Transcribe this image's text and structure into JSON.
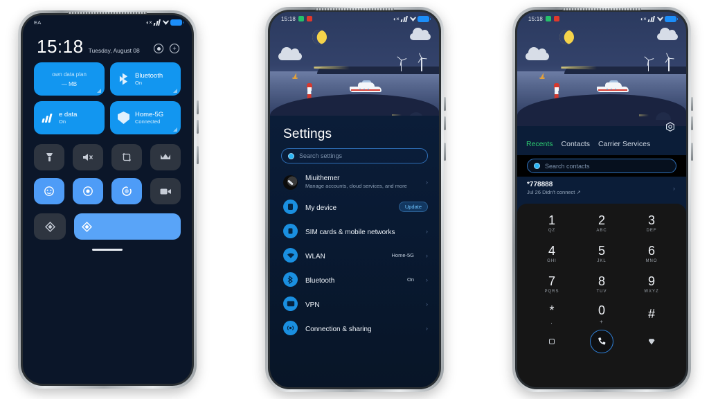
{
  "phone1": {
    "statusbar": {
      "carrier": "EA",
      "icons": [
        "mute-icon",
        "signal-icon",
        "wifi-icon",
        "battery-icon"
      ]
    },
    "clock": {
      "time": "15:18",
      "date": "Tuesday, August 08"
    },
    "header_actions": [
      {
        "name": "user-settings-icon",
        "glyph": "◉"
      },
      {
        "name": "add-icon",
        "glyph": "+"
      }
    ],
    "big_tiles": [
      {
        "name": "data-plan-tile",
        "title": "own data plan",
        "value": "— MB",
        "state": "on",
        "icon": "none"
      },
      {
        "name": "bluetooth-tile",
        "title": "Bluetooth",
        "sub": "On",
        "state": "on",
        "icon": "bluetooth-icon"
      },
      {
        "name": "mobile-data-tile",
        "title": "e data",
        "sub": "On",
        "state": "on",
        "icon": "signal-bars-icon"
      },
      {
        "name": "wifi-tile",
        "title": "Home-5G",
        "sub": "Connected",
        "state": "on",
        "icon": "shield-wifi-icon"
      }
    ],
    "toggles": [
      {
        "name": "flashlight-toggle",
        "icon": "flashlight-icon",
        "state": "off",
        "glyph": "🔦"
      },
      {
        "name": "silent-toggle",
        "icon": "speaker-mute-icon",
        "state": "off",
        "glyph": "🔇"
      },
      {
        "name": "screenshot-toggle",
        "icon": "crop-icon",
        "state": "off",
        "glyph": "⛶"
      },
      {
        "name": "dnd-toggle",
        "icon": "crown-icon",
        "state": "off",
        "glyph": "♛"
      },
      {
        "name": "auto-brightness-toggle",
        "icon": "brightness-icon",
        "state": "on",
        "glyph": "☻"
      },
      {
        "name": "location-toggle",
        "icon": "target-icon",
        "state": "on",
        "glyph": "◎"
      },
      {
        "name": "autorotate-toggle",
        "icon": "rotate-icon",
        "state": "on",
        "glyph": "⟳"
      },
      {
        "name": "screen-record-toggle",
        "icon": "video-camera-icon",
        "state": "off",
        "glyph": "▣"
      }
    ],
    "bottom_row": {
      "button": {
        "name": "brightness-small-button",
        "icon": "diamond-icon",
        "state": "off"
      },
      "slider": {
        "name": "brightness-slider",
        "icon": "diamond-icon",
        "state": "on"
      }
    }
  },
  "phone2": {
    "statusbar": {
      "time": "15:18",
      "notifications": [
        "green-app-icon",
        "red-app-icon"
      ]
    },
    "title": "Settings",
    "search": {
      "placeholder": "Search settings"
    },
    "items": [
      {
        "name": "account-row",
        "icon": "avatar-icon",
        "title": "Miuithemer",
        "subtitle": "Manage accounts, cloud services, and more",
        "value": "",
        "badge": "",
        "chevron": "›"
      },
      {
        "name": "my-device-row",
        "icon": "device-icon",
        "title": "My device",
        "subtitle": "",
        "value": "",
        "badge": "Update",
        "chevron": ""
      },
      {
        "name": "sim-networks-row",
        "icon": "sim-icon",
        "title": "SIM cards & mobile networks",
        "subtitle": "",
        "value": "",
        "badge": "",
        "chevron": "›"
      },
      {
        "name": "wlan-row",
        "icon": "wifi-icon",
        "title": "WLAN",
        "subtitle": "",
        "value": "Home-5G",
        "badge": "",
        "chevron": "›"
      },
      {
        "name": "bluetooth-row",
        "icon": "bluetooth-icon",
        "title": "Bluetooth",
        "subtitle": "",
        "value": "On",
        "badge": "",
        "chevron": "›"
      },
      {
        "name": "vpn-row",
        "icon": "vpn-icon",
        "title": "VPN",
        "subtitle": "",
        "value": "",
        "badge": "",
        "chevron": "›"
      },
      {
        "name": "connection-sharing-row",
        "icon": "sharing-icon",
        "title": "Connection & sharing",
        "subtitle": "",
        "value": "",
        "badge": "",
        "chevron": "›"
      }
    ]
  },
  "phone3": {
    "statusbar": {
      "time": "15:18",
      "notifications": [
        "green-app-icon",
        "red-app-icon"
      ]
    },
    "settings_icon": "gear-icon",
    "tabs": [
      {
        "name": "tab-recents",
        "label": "Recents",
        "active": true
      },
      {
        "name": "tab-contacts",
        "label": "Contacts",
        "active": false
      },
      {
        "name": "tab-carrier-services",
        "label": "Carrier Services",
        "active": false
      }
    ],
    "search": {
      "placeholder": "Search contacts"
    },
    "recent_call": {
      "number": "*778888",
      "detail": "Jul 26 Didn't connect  ↗",
      "chevron": "›"
    },
    "keypad": [
      {
        "digit": "1",
        "letters": "QZ"
      },
      {
        "digit": "2",
        "letters": "ABC"
      },
      {
        "digit": "3",
        "letters": "DEF"
      },
      {
        "digit": "4",
        "letters": "GHI"
      },
      {
        "digit": "5",
        "letters": "JKL"
      },
      {
        "digit": "6",
        "letters": "MNO"
      },
      {
        "digit": "7",
        "letters": "PQRS"
      },
      {
        "digit": "8",
        "letters": "TUV"
      },
      {
        "digit": "9",
        "letters": "WXYZ"
      },
      {
        "digit": "*",
        "letters": ","
      },
      {
        "digit": "0",
        "letters": "+"
      },
      {
        "digit": "#",
        "letters": ""
      }
    ],
    "actions": {
      "left": {
        "name": "video-call-button",
        "icon": "square-icon"
      },
      "call": {
        "name": "call-button",
        "icon": "phone-icon",
        "glyph": "📞"
      },
      "right": {
        "name": "voicemail-button",
        "icon": "shield-icon"
      }
    }
  },
  "colors": {
    "accent_blue": "#1296f0",
    "toggle_on": "#4e9cf7",
    "toggle_off": "#2e3540",
    "screen_bg": "#0b1629",
    "settings_bg": "#0b1d38",
    "keypad_bg": "#161616",
    "tab_active_green": "#2ecf72",
    "search_border": "#2f6fb8"
  }
}
